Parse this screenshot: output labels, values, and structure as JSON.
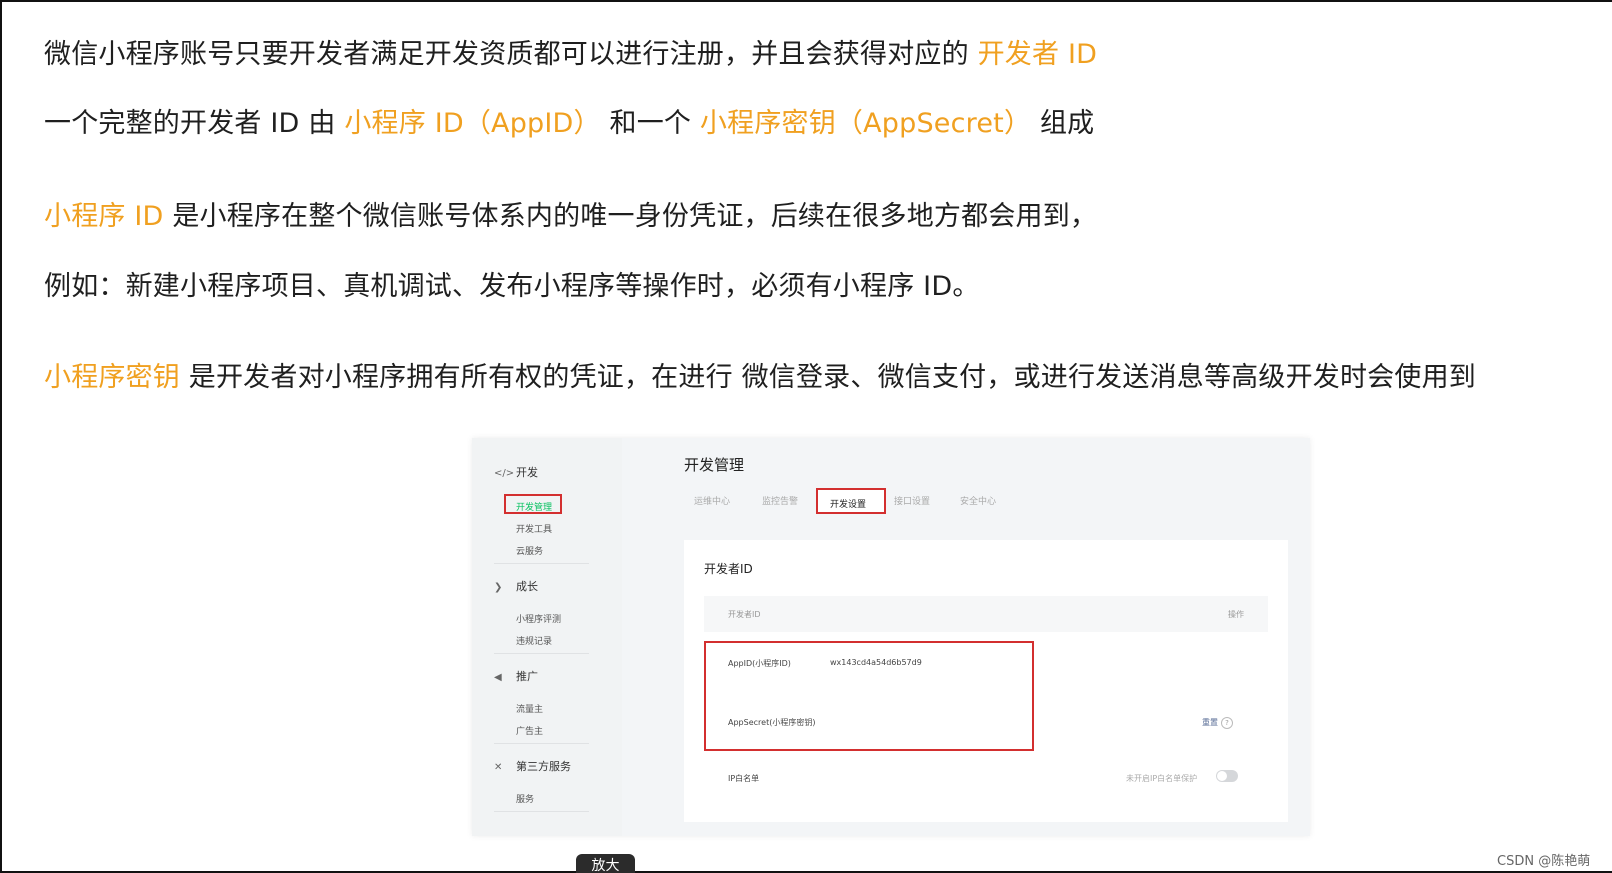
{
  "paragraphs": {
    "p1": {
      "text": "微信小程序账号只要开发者满足开发资质都可以进行注册，并且会获得对应的 ",
      "hl": "开发者 ID"
    },
    "p2": {
      "a": "一个完整的开发者 ID 由 ",
      "hl1": "小程序 ID（AppID）",
      "b": " 和一个 ",
      "hl2": "小程序密钥（AppSecret）",
      "c": " 组成"
    },
    "p3": {
      "hl": "小程序 ID",
      "text": " 是小程序在整个微信账号体系内的唯一身份凭证，后续在很多地方都会用到，"
    },
    "p4": {
      "text": "例如：新建小程序项目、真机调试、发布小程序等操作时，必须有小程序 ID。"
    },
    "p5": {
      "hl": "小程序密钥",
      "text": " 是开发者对小程序拥有所有权的凭证，在进行 微信登录、微信支付，或进行发送消息等高级开发时会使用到"
    }
  },
  "screenshot": {
    "sidebar": {
      "group_dev": "开发",
      "dev_items": [
        "开发管理",
        "开发工具",
        "云服务"
      ],
      "group_growth": "成长",
      "growth_items": [
        "小程序评测",
        "违规记录"
      ],
      "group_promo": "推广",
      "promo_items": [
        "流量主",
        "广告主"
      ],
      "group_third": "第三方服务",
      "third_items": [
        "服务"
      ]
    },
    "title": "开发管理",
    "tabs": [
      "运维中心",
      "监控告警",
      "开发设置",
      "接口设置",
      "安全中心"
    ],
    "card": {
      "title": "开发者ID",
      "col_id": "开发者ID",
      "col_op": "操作",
      "appid_label": "AppID(小程序ID)",
      "appid_value": "wx143cd4a54d6b57d9",
      "secret_label": "AppSecret(小程序密钥)",
      "secret_action": "重置",
      "ip_label": "IP白名单",
      "ip_hint": "未开启IP白名单保护"
    }
  },
  "overlay": {
    "zoom_label": "放大"
  },
  "watermark": "CSDN @陈艳萌",
  "colors": {
    "highlight": "#f0a020",
    "redbox": "#d32f2f",
    "wechat_green": "#07c160"
  }
}
